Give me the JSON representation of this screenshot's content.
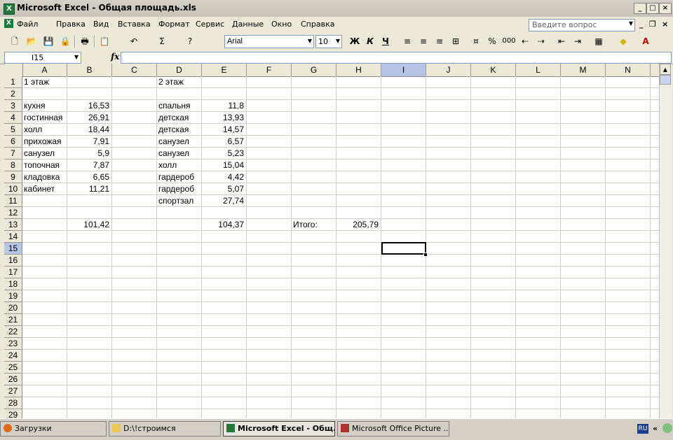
{
  "window": {
    "title": "Microsoft Excel - Общая площадь.xls",
    "app_icon_glyph": "X"
  },
  "menu": {
    "items": [
      "Файл",
      "Правка",
      "Вид",
      "Вставка",
      "Формат",
      "Сервис",
      "Данные",
      "Окно",
      "Справка"
    ],
    "help_placeholder": "Введите вопрос"
  },
  "toolbar": {
    "font": "Arial",
    "size": "10",
    "bold": "Ж",
    "italic": "К",
    "underline": "Ч",
    "percent": "%",
    "thousands": "000"
  },
  "formula_bar": {
    "name_box": "I15",
    "fx": "fx",
    "formula": ""
  },
  "columns": [
    "A",
    "B",
    "C",
    "D",
    "E",
    "F",
    "G",
    "H",
    "I",
    "J",
    "K",
    "L",
    "M",
    "N"
  ],
  "rows": [
    "1",
    "2",
    "3",
    "4",
    "5",
    "6",
    "7",
    "8",
    "9",
    "10",
    "11",
    "12",
    "13",
    "14",
    "15",
    "16",
    "17",
    "18",
    "19",
    "20",
    "21",
    "22",
    "23",
    "24",
    "25",
    "26",
    "27",
    "28",
    "29"
  ],
  "cells": {
    "A1": "1 этаж",
    "D1": "2 этаж",
    "A3": "кухня",
    "B3": "16,53",
    "D3": "спальня",
    "E3": "11,8",
    "A4": "гостинная",
    "B4": "26,91",
    "D4": "детская",
    "E4": "13,93",
    "A5": "холл",
    "B5": "18,44",
    "D5": "детская",
    "E5": "14,57",
    "A6": "прихожая",
    "B6": "7,91",
    "D6": "санузел",
    "E6": "6,57",
    "A7": "санузел",
    "B7": "5,9",
    "D7": "санузел",
    "E7": "5,23",
    "A8": "топочная",
    "B8": "7,87",
    "D8": "холл",
    "E8": "15,04",
    "A9": "кладовка",
    "B9": "6,65",
    "D9": "гардероб",
    "E9": "4,42",
    "A10": "кабинет",
    "B10": "11,21",
    "D10": "гардероб",
    "E10": "5,07",
    "D11": "спортзал",
    "E11": "27,74",
    "B13": "101,42",
    "E13": "104,37",
    "G13": "Итого:",
    "H13": "205,79"
  },
  "taskbar": {
    "tasks": [
      {
        "label": "Загрузки"
      },
      {
        "label": "D:\\!строимся"
      },
      {
        "label": "Microsoft Excel - Общ..."
      },
      {
        "label": "Microsoft Office Picture ..."
      }
    ],
    "lang": "RU",
    "tray_arrow": "«"
  }
}
